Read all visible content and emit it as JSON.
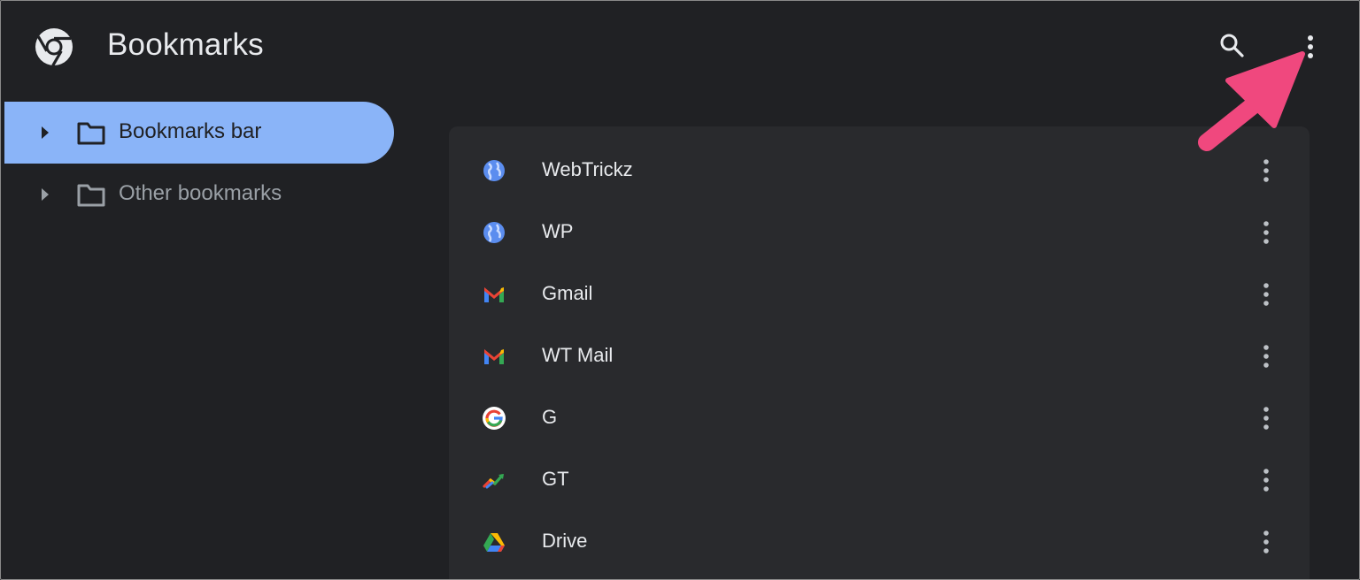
{
  "header": {
    "title": "Bookmarks",
    "logo_icon": "chrome-logo-icon",
    "search_icon": "search-icon",
    "menu_icon": "more-vert-icon"
  },
  "sidebar": {
    "items": [
      {
        "label": "Bookmarks bar",
        "icon": "folder-icon",
        "selected": true
      },
      {
        "label": "Other bookmarks",
        "icon": "folder-icon",
        "selected": false
      }
    ]
  },
  "bookmarks": [
    {
      "name": "WebTrickz",
      "icon": "globe-icon"
    },
    {
      "name": "WP",
      "icon": "globe-icon"
    },
    {
      "name": "Gmail",
      "icon": "gmail-icon"
    },
    {
      "name": "WT Mail",
      "icon": "gmail-icon"
    },
    {
      "name": "G",
      "icon": "google-icon"
    },
    {
      "name": "GT",
      "icon": "google-trends-icon"
    },
    {
      "name": "Drive",
      "icon": "google-drive-icon"
    }
  ],
  "colors": {
    "background": "#202124",
    "selected": "#8ab4f8",
    "card": "#292a2d",
    "annotation": "#f0487e"
  }
}
